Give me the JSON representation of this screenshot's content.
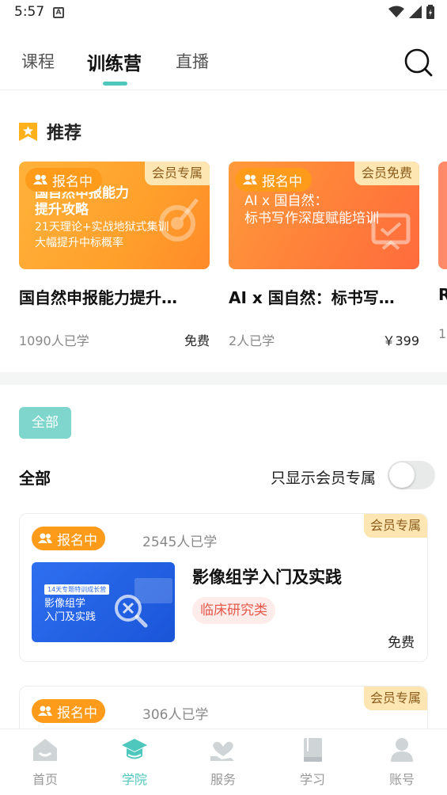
{
  "status_bar": {
    "time": "5:57",
    "notification_glyph": "A"
  },
  "top_tabs": [
    {
      "label": "课程"
    },
    {
      "label": "训练营"
    },
    {
      "label": "直播"
    }
  ],
  "recommend": {
    "title": "推荐",
    "cards": [
      {
        "status": "报名中",
        "member_badge": "会员专属",
        "image_lines": [
          "国自然申报能力",
          "提升攻略",
          "21天理论+实战地狱式集训",
          "大幅提升中标概率"
        ],
        "title": "国自然申报能力提升…",
        "learners": "1090人已学",
        "price": "免费"
      },
      {
        "status": "报名中",
        "member_badge": "会员免费",
        "image_lines": [
          "AI x 国自然：",
          "标书写作深度赋能培训"
        ],
        "title": "AI x 国自然：标书写…",
        "learners": "2人已学",
        "price": "￥399"
      },
      {
        "title": "R",
        "learners": "1"
      }
    ]
  },
  "filter": {
    "chip_label": "全部",
    "heading": "全部",
    "member_only_label": "只显示会员专属",
    "member_only_on": false
  },
  "list": [
    {
      "status": "报名中",
      "learners": "2545人已学",
      "member_badge": "会员专属",
      "thumb_tag": "14天专题特训成长营",
      "thumb_lines": [
        "影像组学",
        "入门及实践"
      ],
      "title": "影像组学入门及实践",
      "category": "临床研究类",
      "price": "免费"
    },
    {
      "status": "报名中",
      "learners": "306人已学",
      "member_badge": "会员专属"
    }
  ],
  "bottom_nav": [
    {
      "label": "首页",
      "icon": "home-icon"
    },
    {
      "label": "学院",
      "icon": "graduation-cap-icon",
      "active": true
    },
    {
      "label": "服务",
      "icon": "heart-hand-icon"
    },
    {
      "label": "学习",
      "icon": "book-icon"
    },
    {
      "label": "账号",
      "icon": "user-icon"
    }
  ],
  "colors": {
    "accent": "#4ec7bd",
    "status_orange": "#ff9b1a",
    "member_badge_bg": "#fde6b2",
    "tag_red": "#e5584a"
  }
}
